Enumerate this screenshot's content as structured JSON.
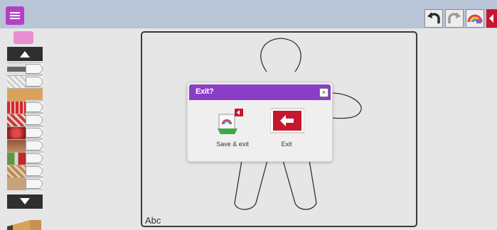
{
  "toolbar": {
    "menu_icon": "hamburger-menu-icon",
    "undo_icon": "undo-icon",
    "redo_icon": "redo-icon",
    "color_icon": "rainbow-icon",
    "exit_icon": "exit-arrow-icon"
  },
  "sidebar": {
    "eraser_icon": "eraser-icon",
    "scroll_up_icon": "up-arrow-icon",
    "scroll_down_icon": "down-arrow-icon",
    "brushes": [
      {
        "name": "dark-grey-brush",
        "color": "#666666"
      },
      {
        "name": "checker-brush",
        "color": "#cfcfcf"
      },
      {
        "name": "sand-brush",
        "color": "#d9a35b"
      },
      {
        "name": "red-pattern-brush",
        "color": "#d02a2a"
      },
      {
        "name": "candy-brush",
        "color": "#c33d3d"
      },
      {
        "name": "berry-brush",
        "color": "#b8232e"
      },
      {
        "name": "brown-brush",
        "color": "#8c5a3a"
      },
      {
        "name": "holly-brush",
        "color": "#5c9a3a"
      },
      {
        "name": "gingerbread-brush",
        "color": "#b98a5c"
      }
    ],
    "pencil_icon": "pencil-icon"
  },
  "canvas": {
    "text": "Abc",
    "outline_color": "#333333"
  },
  "dialog": {
    "title": "Exit?",
    "close_label": "×",
    "options": [
      {
        "label": "Save & exit",
        "icon": "save-exit-icon"
      },
      {
        "label": "Exit",
        "icon": "exit-icon"
      }
    ],
    "header_color": "#8a3ec7"
  },
  "colors": {
    "accent": "#b43fc6",
    "exit_red": "#c6172f"
  }
}
